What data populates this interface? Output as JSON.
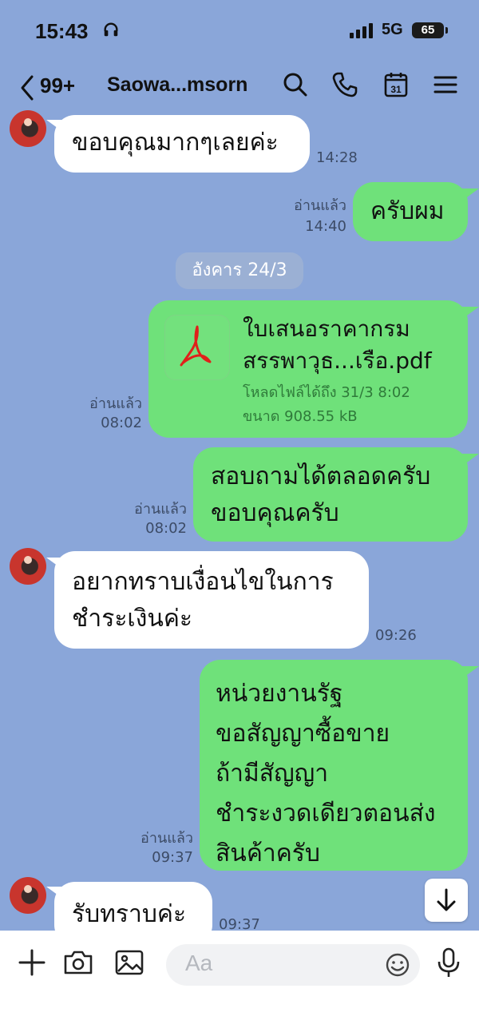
{
  "status": {
    "time": "15:43",
    "network": "5G",
    "battery": "65"
  },
  "header": {
    "unread_count": "99+",
    "chat_name": "Saowa...msorn"
  },
  "messages": {
    "m1": {
      "text": "ขอบคุณมากๆเลยค่ะ",
      "time": "14:28"
    },
    "m2": {
      "text": "ครับผม",
      "read": "อ่านแล้ว",
      "time": "14:40"
    },
    "date_divider": "อังคาร 24/3",
    "file": {
      "name_line1": "ใบเสนอราคากรม",
      "name_line2": "สรรพาวุธ...เรือ.pdf",
      "download_until": "โหลดไฟล์ได้ถึง 31/3 8:02",
      "size": "ขนาด 908.55 kB",
      "read": "อ่านแล้ว",
      "time": "08:02"
    },
    "m4": {
      "line1": "สอบถามได้ตลอดครับ",
      "line2": "ขอบคุณครับ",
      "read": "อ่านแล้ว",
      "time": "08:02"
    },
    "m5": {
      "line1": "อยากทราบเงื่อนไขในการ",
      "line2": "ชำระเงินค่ะ",
      "time": "09:26"
    },
    "m6": {
      "line1": "หน่วยงานรัฐ",
      "line2": "ขอสัญญาซื้อขาย",
      "line3": "ถ้ามีสัญญา",
      "line4": "ชำระงวดเดียวตอนส่ง",
      "line5": "สินค้าครับ",
      "read": "อ่านแล้ว",
      "time": "09:37"
    },
    "m7": {
      "text": "รับทราบค่ะ",
      "time": "09:37"
    }
  },
  "composer": {
    "placeholder": "Aa"
  }
}
